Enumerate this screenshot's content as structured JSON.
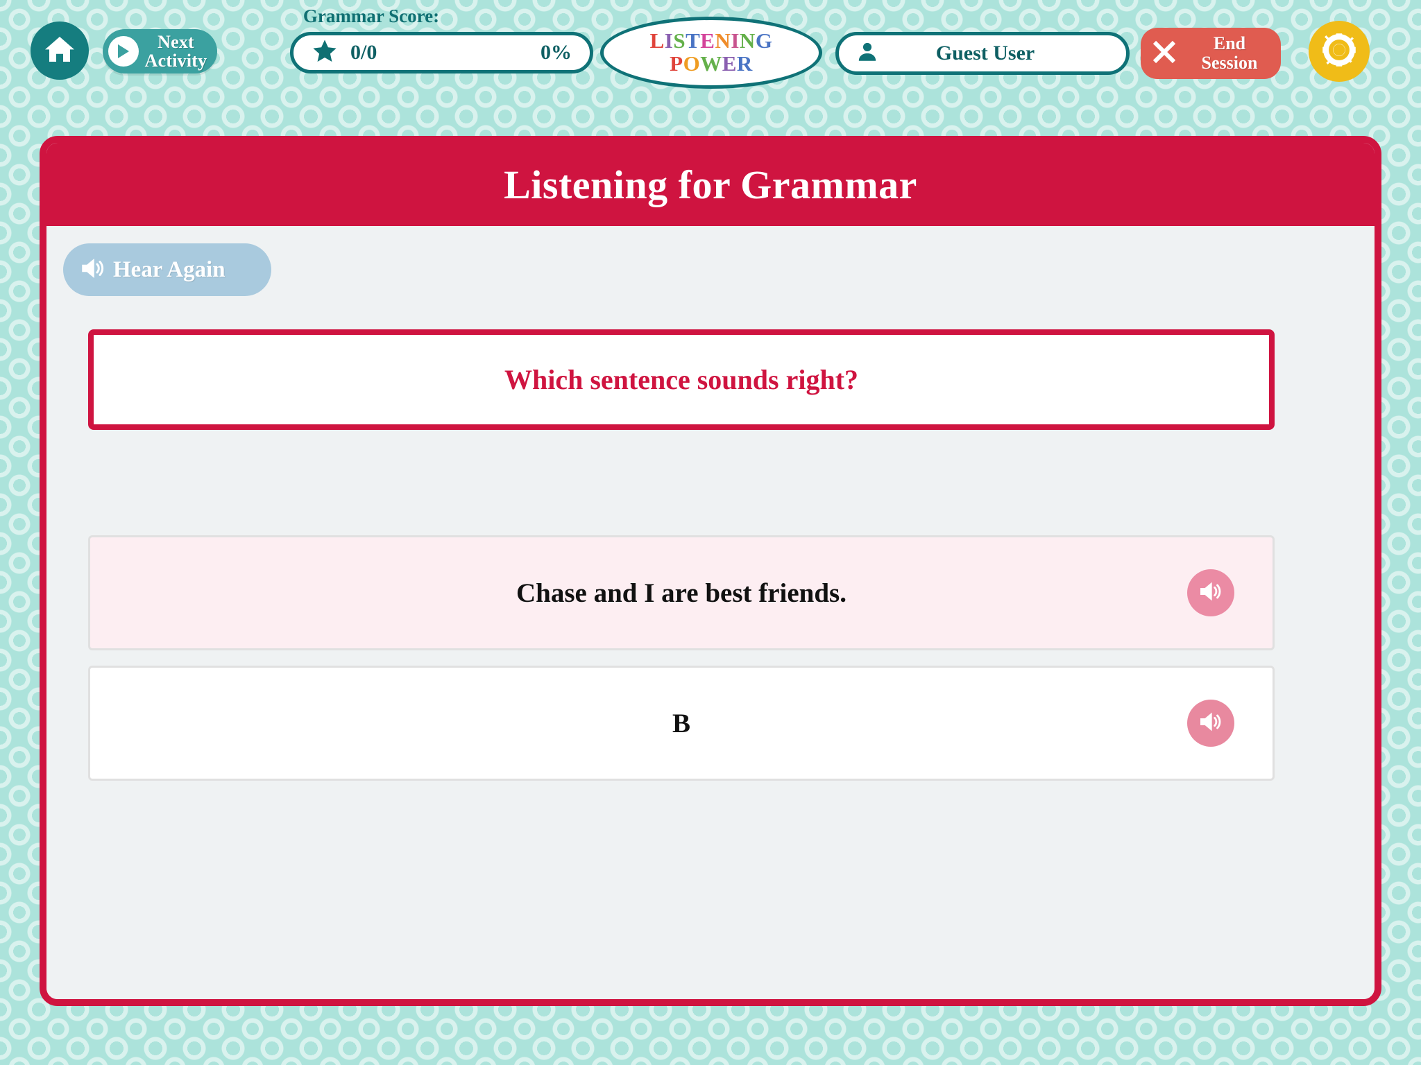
{
  "header": {
    "home_icon": "home-icon",
    "next_activity": {
      "label_line1": "Next",
      "label_line2": "Activity",
      "icon": "play-icon"
    },
    "score": {
      "caption": "Grammar Score:",
      "icon": "star-icon",
      "fraction": "0/0",
      "percent": "0%"
    },
    "logo": {
      "line1": "LISTENING",
      "line2": "POWER",
      "line1_letters": [
        {
          "ch": "L",
          "color": "#e0443b"
        },
        {
          "ch": "I",
          "color": "#8a5fb0"
        },
        {
          "ch": "S",
          "color": "#64b04a"
        },
        {
          "ch": "T",
          "color": "#4a74c4"
        },
        {
          "ch": "E",
          "color": "#d4439a"
        },
        {
          "ch": "N",
          "color": "#ef8c2a"
        },
        {
          "ch": "I",
          "color": "#c8548f"
        },
        {
          "ch": "N",
          "color": "#64b04a"
        },
        {
          "ch": "G",
          "color": "#4a74c4"
        }
      ],
      "line2_letters": [
        {
          "ch": "P",
          "color": "#e0443b"
        },
        {
          "ch": "O",
          "color": "#ef9c22"
        },
        {
          "ch": "W",
          "color": "#64b04a"
        },
        {
          "ch": "E",
          "color": "#8a5fb0"
        },
        {
          "ch": "R",
          "color": "#4a74c4"
        }
      ]
    },
    "user": {
      "icon": "person-icon",
      "name": "Guest User"
    },
    "end_session": {
      "icon": "close-x-icon",
      "label_line1": "End",
      "label_line2": "Session"
    },
    "settings": {
      "icon": "gear-icon"
    }
  },
  "activity": {
    "title": "Listening for Grammar",
    "hear_again": {
      "label": "Hear Again",
      "icon": "speaker-icon"
    },
    "question": "Which sentence sounds right?",
    "options": [
      {
        "label": "Chase and I are best friends.",
        "selected": true,
        "speaker_icon": "speaker-icon"
      },
      {
        "label": "B",
        "selected": false,
        "speaker_icon": "speaker-icon"
      }
    ]
  },
  "colors": {
    "background_mint": "#ace3db",
    "teal": "#0f7277",
    "teal_dark": "#157d7f",
    "teal_light": "#3ba1a0",
    "crimson": "#cf1440",
    "salmon": "#e05c50",
    "yellow": "#f0bc18",
    "pink": "#eb8ba4",
    "pale_pink": "#fdeef2",
    "light_blue": "#a9cade",
    "panel_grey": "#eff2f3"
  }
}
